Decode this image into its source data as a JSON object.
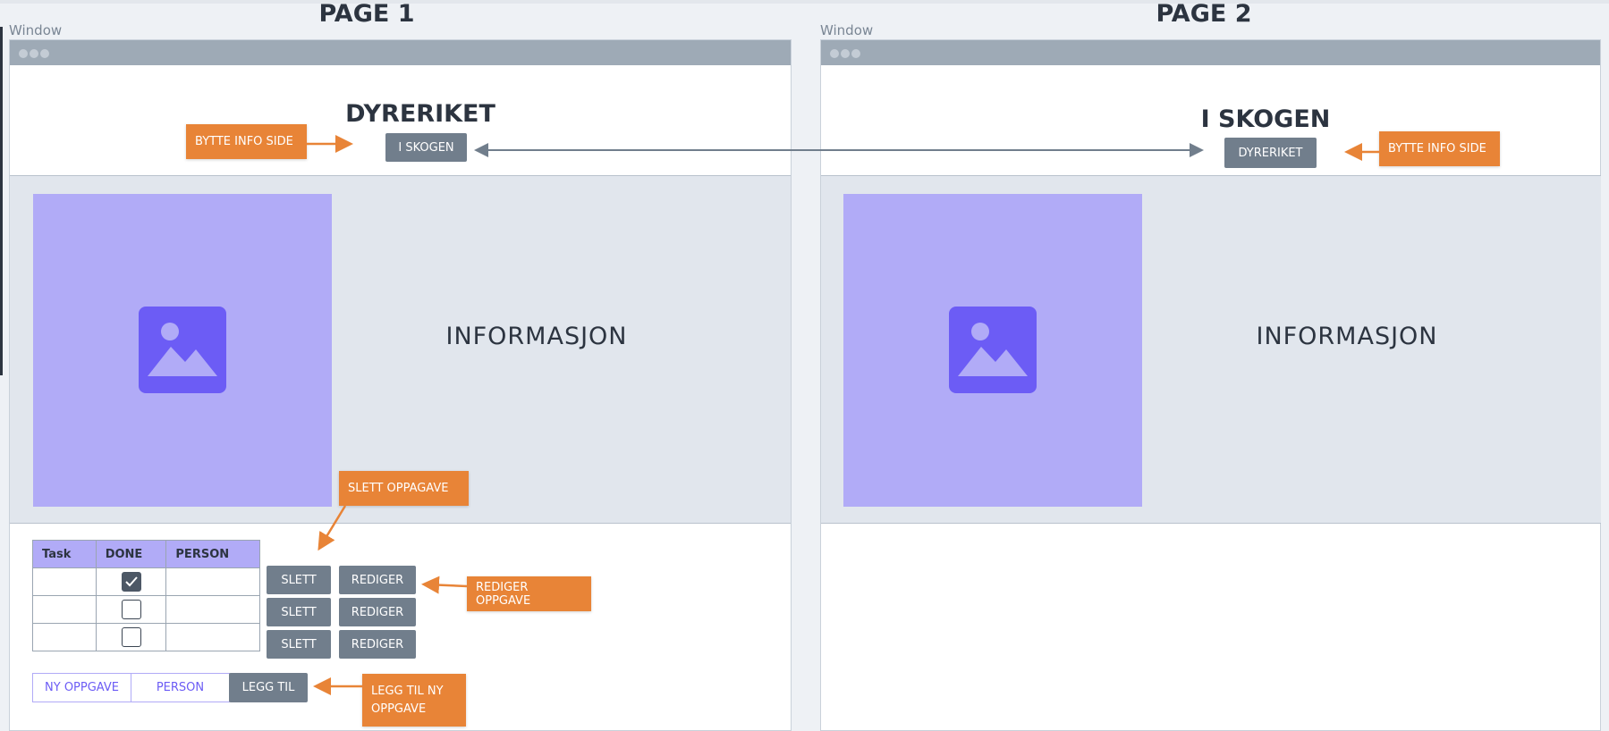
{
  "pages": [
    {
      "title": "PAGE 1",
      "window_label": "Window",
      "heading": "DYRERIKET",
      "switch_button": "I SKOGEN",
      "info_text": "INFORMASJON"
    },
    {
      "title": "PAGE 2",
      "window_label": "Window",
      "heading": "I SKOGEN",
      "switch_button": "DYRERIKET",
      "info_text": "INFORMASJON"
    }
  ],
  "table": {
    "headers": [
      "Task",
      "DONE",
      "PERSON"
    ],
    "rows": [
      {
        "task": "",
        "done": true,
        "person": ""
      },
      {
        "task": "",
        "done": false,
        "person": ""
      },
      {
        "task": "",
        "done": false,
        "person": ""
      }
    ]
  },
  "row_actions": {
    "delete_label": "SLETT",
    "edit_label": "REDIGER"
  },
  "add_form": {
    "task_field": "NY OPPGAVE",
    "person_field": "PERSON",
    "add_button": "LEGG TIL"
  },
  "callouts": {
    "switch_page_1": "BYTTE INFO SIDE",
    "switch_page_2": "BYTTE INFO SIDE",
    "delete_task": "SLETT OPPAGAVE",
    "edit_task": "REDIGER OPPGAVE",
    "add_task_line1": "LEGG TIL NY",
    "add_task_line2": "OPPGAVE"
  },
  "colors": {
    "callout": "#e88437",
    "button": "#717e8c",
    "image_placeholder": "#b1abf7",
    "image_icon": "#6c5cf5",
    "content_background": "#e1e6ed",
    "titlebar": "#9eaab6"
  },
  "icons": {
    "image_placeholder": "image-icon",
    "checkbox_checked": "checkmark-icon",
    "window_controls": "window-dots-icon"
  }
}
